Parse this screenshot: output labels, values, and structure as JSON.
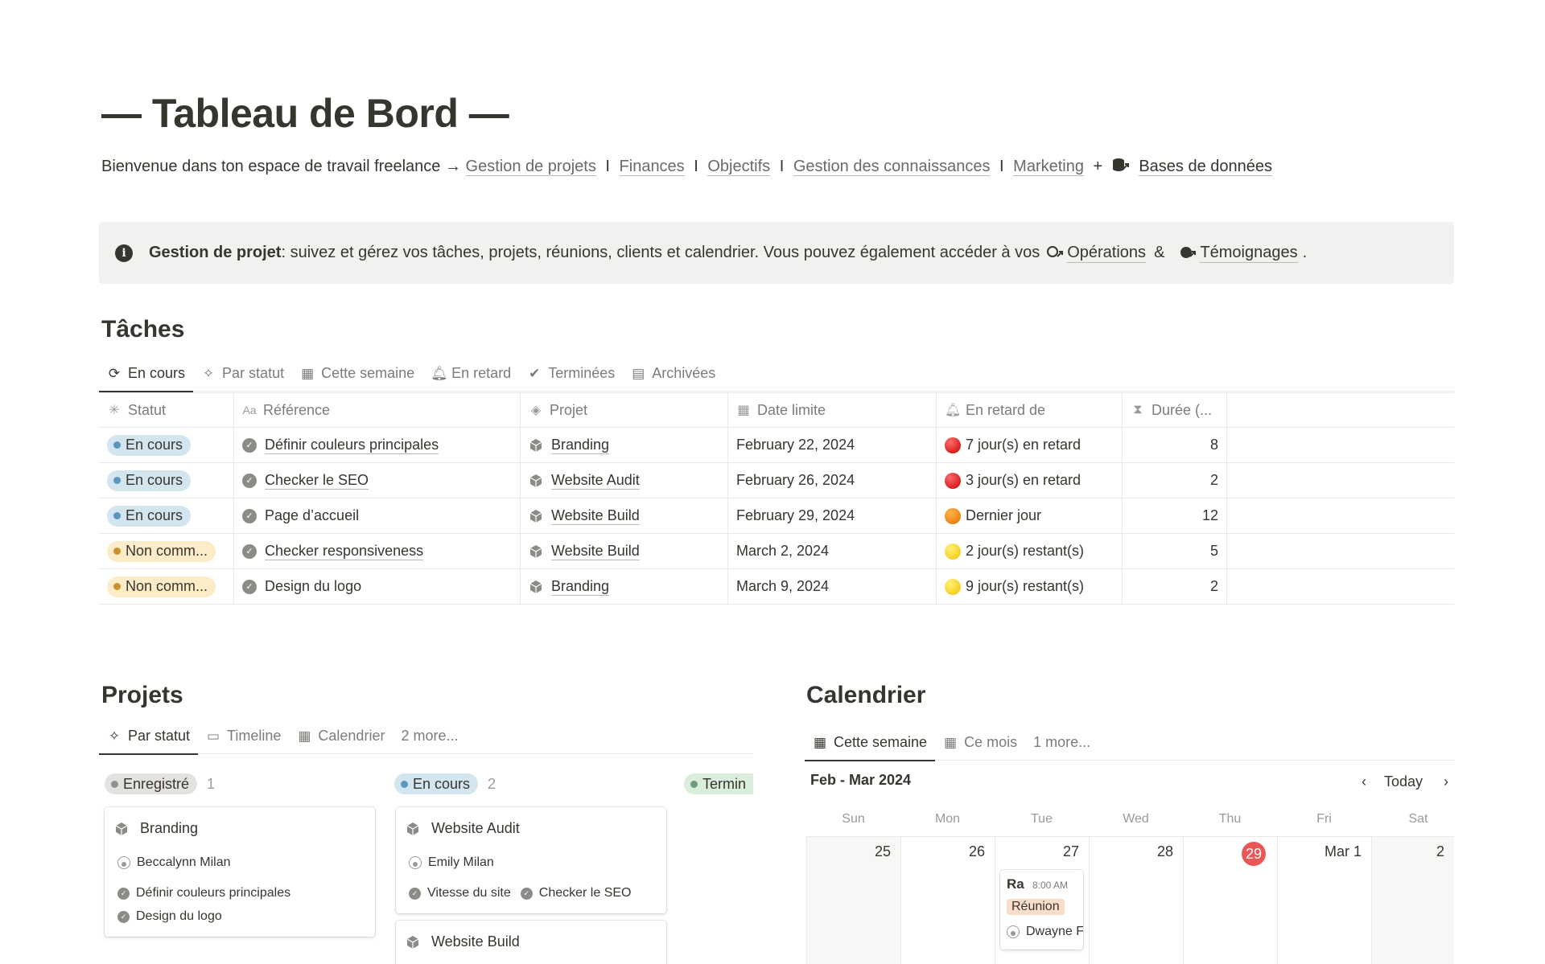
{
  "page": {
    "title": "— Tableau de Bord —",
    "intro_text": "Bienvenue dans ton espace de travail freelance →",
    "intro_links": [
      "Gestion de projets",
      "Finances",
      "Objectifs",
      "Gestion des connaissances",
      "Marketing"
    ],
    "separator": "I",
    "plus": "+",
    "db_link": "Bases de données"
  },
  "callout": {
    "bold": "Gestion de projet",
    "text": " : suivez et gérez vos tâches, projets, réunions, clients et calendrier. Vous pouvez également accéder à vos",
    "link1": "Opérations",
    "amp": "&",
    "link2": "Témoignages",
    "end": "."
  },
  "tasks": {
    "heading": "Tâches",
    "tabs": [
      {
        "label": "En cours",
        "icon": "sync-icon"
      },
      {
        "label": "Par statut",
        "icon": "sparkle-icon"
      },
      {
        "label": "Cette semaine",
        "icon": "calendar-icon"
      },
      {
        "label": "En retard",
        "icon": "bell-icon"
      },
      {
        "label": "Terminées",
        "icon": "check-circle-icon"
      },
      {
        "label": "Archivées",
        "icon": "archive-icon"
      }
    ],
    "columns": [
      "Statut",
      "Référence",
      "Projet",
      "Date limite",
      "En retard de",
      "Durée (..."
    ],
    "rows": [
      {
        "status": "En cours",
        "ref": "Définir couleurs principales",
        "project": "Branding",
        "date": "February 22, 2024",
        "late": "7 jour(s) en retard",
        "duration": "8"
      },
      {
        "status": "En cours",
        "ref": "Checker le SEO",
        "project": "Website Audit",
        "date": "February 26, 2024",
        "late": "3 jour(s) en retard",
        "duration": "2"
      },
      {
        "status": "En cours",
        "ref": "Page d’accueil",
        "project": "Website Build",
        "date": "February 29, 2024",
        "late": "Dernier jour",
        "duration": "12"
      },
      {
        "status": "Non comm...",
        "ref": "Checker responsiveness",
        "project": "Website Build",
        "date": "March 2, 2024",
        "late": "2 jour(s) restant(s)",
        "duration": "5"
      },
      {
        "status": "Non comm...",
        "ref": "Design du logo",
        "project": "Branding",
        "date": "March 9, 2024",
        "late": "9 jour(s) restant(s)",
        "duration": "2"
      }
    ]
  },
  "projects": {
    "heading": "Projets",
    "tabs": [
      {
        "label": "Par statut",
        "icon": "sparkle-icon"
      },
      {
        "label": "Timeline",
        "icon": "timeline-icon"
      },
      {
        "label": "Calendrier",
        "icon": "calendar-icon"
      },
      {
        "label": "2 more...",
        "icon": ""
      }
    ],
    "groups": [
      {
        "label": "Enregistré",
        "count": "1"
      },
      {
        "label": "En cours",
        "count": "2"
      },
      {
        "label": "Termin",
        "count": ""
      }
    ],
    "cards": [
      {
        "title": "Branding",
        "person": "Beccalynn Milan",
        "tasks": [
          "Définir couleurs principales",
          "Design du logo"
        ]
      },
      {
        "title": "Website Audit",
        "person": "Emily Milan",
        "tasks": [
          "Vitesse du site",
          "Checker le SEO"
        ]
      },
      {
        "title": "Website Build",
        "person": "",
        "tasks": []
      }
    ]
  },
  "calendar": {
    "heading": "Calendrier",
    "tabs": [
      {
        "label": "Cette semaine",
        "icon": "calendar-icon"
      },
      {
        "label": "Ce mois",
        "icon": "calendar-icon"
      },
      {
        "label": "1 more...",
        "icon": ""
      }
    ],
    "range": "Feb - Mar 2024",
    "today_label": "Today",
    "day_names": [
      "Sun",
      "Mon",
      "Tue",
      "Wed",
      "Thu",
      "Fri",
      "Sat"
    ],
    "dates": [
      "25",
      "26",
      "27",
      "28",
      "29",
      "Mar 1",
      "2"
    ],
    "event": {
      "title": "Ra",
      "time": "8:00 AM",
      "tag": "Réunion",
      "person": "Dwayne F"
    }
  },
  "colors": {
    "text": "#37352f",
    "muted": "#7d7c78",
    "today": "#eb5757",
    "status_blue": "#d3e5ef",
    "status_yellow": "#fdecc8"
  }
}
